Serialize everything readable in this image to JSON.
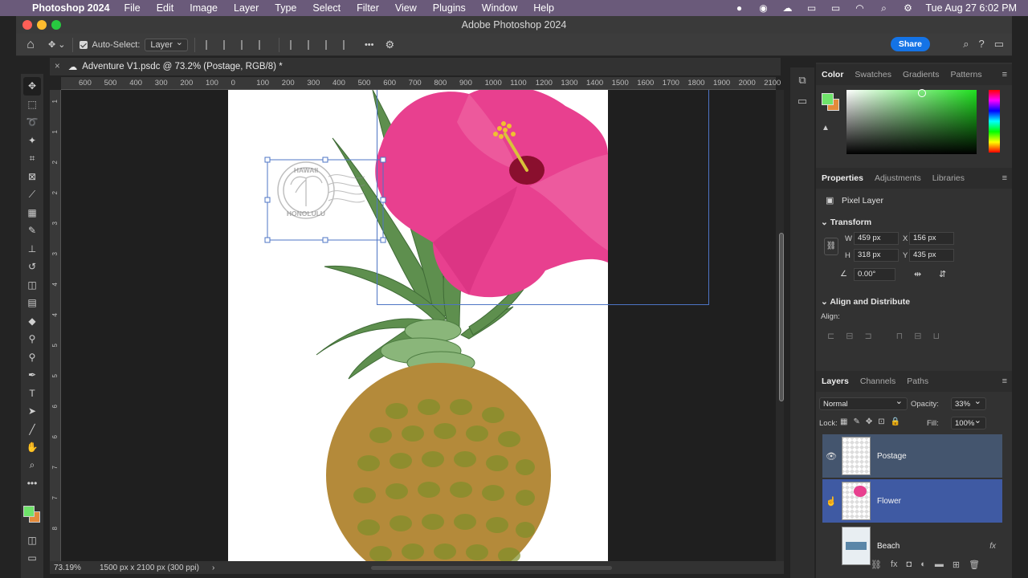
{
  "menubar": {
    "app": "Photoshop 2024",
    "items": [
      "File",
      "Edit",
      "Image",
      "Layer",
      "Type",
      "Select",
      "Filter",
      "View",
      "Plugins",
      "Window",
      "Help"
    ],
    "clock": "Tue Aug 27  6:02 PM"
  },
  "window": {
    "title": "Adobe Photoshop 2024"
  },
  "options": {
    "autoselect_label": "Auto-Select:",
    "autoselect_value": "Layer",
    "more": "•••",
    "share": "Share"
  },
  "document": {
    "tab_title": "Adventure V1.psdc @ 73.2% (Postage, RGB/8) *",
    "zoom": "73.19%",
    "size_info": "1500 px x 2100 px (300 ppi)"
  },
  "ruler": {
    "h_ticks": [
      "600",
      "500",
      "400",
      "300",
      "200",
      "100",
      "0",
      "100",
      "200",
      "300",
      "400",
      "500",
      "600",
      "700",
      "800",
      "900",
      "1000",
      "1100",
      "1200",
      "1300",
      "1400",
      "1500",
      "1600",
      "1700",
      "1800",
      "1900",
      "2000",
      "2100"
    ],
    "v_ticks": [
      "1",
      "1",
      "2",
      "2",
      "3",
      "3",
      "4",
      "4",
      "5",
      "5",
      "6",
      "6",
      "7",
      "7",
      "8"
    ]
  },
  "stamp": {
    "top": "HAWAII",
    "bottom": "HONOLULU"
  },
  "color_panel": {
    "tabs": [
      "Color",
      "Swatches",
      "Gradients",
      "Patterns"
    ],
    "fg": "#6fe36a",
    "bg": "#e38a3a"
  },
  "properties": {
    "tabs": [
      "Properties",
      "Adjustments",
      "Libraries"
    ],
    "layer_type": "Pixel Layer",
    "transform_label": "Transform",
    "w_label": "W",
    "w": "459 px",
    "h_label": "H",
    "h": "318 px",
    "x_label": "X",
    "x": "156 px",
    "y_label": "Y",
    "y": "435 px",
    "angle": "0.00°",
    "align_head": "Align and Distribute",
    "align_label": "Align:"
  },
  "layers": {
    "tabs": [
      "Layers",
      "Channels",
      "Paths"
    ],
    "blend_mode": "Normal",
    "opacity_label": "Opacity:",
    "opacity": "33%",
    "lock_label": "Lock:",
    "fill_label": "Fill:",
    "fill": "100%",
    "items": [
      {
        "name": "Postage"
      },
      {
        "name": "Flower"
      },
      {
        "name": "Beach",
        "fx": "fx"
      }
    ]
  }
}
